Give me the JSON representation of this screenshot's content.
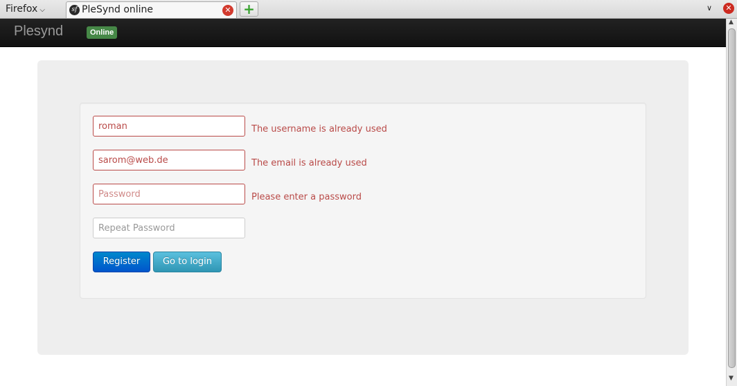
{
  "browser": {
    "menu_label": "Firefox",
    "tab_title": "PleSynd online",
    "new_tab_symbol": "+",
    "favicon_letters": "sf"
  },
  "navbar": {
    "brand": "Plesynd",
    "status_badge": "Online"
  },
  "form": {
    "username": {
      "value": "roman",
      "error": "The username is already used"
    },
    "email": {
      "value": "sarom@web.de",
      "error": "The email is already used"
    },
    "password": {
      "placeholder": "Password",
      "error": "Please enter a password"
    },
    "repeat_password": {
      "placeholder": "Repeat Password"
    },
    "register_label": "Register",
    "go_to_login_label": "Go to login"
  },
  "colors": {
    "error": "#b94a48",
    "badge_success": "#468847",
    "primary": "#0074cc",
    "info": "#49afcd",
    "navbar": "#1b1b1b"
  }
}
